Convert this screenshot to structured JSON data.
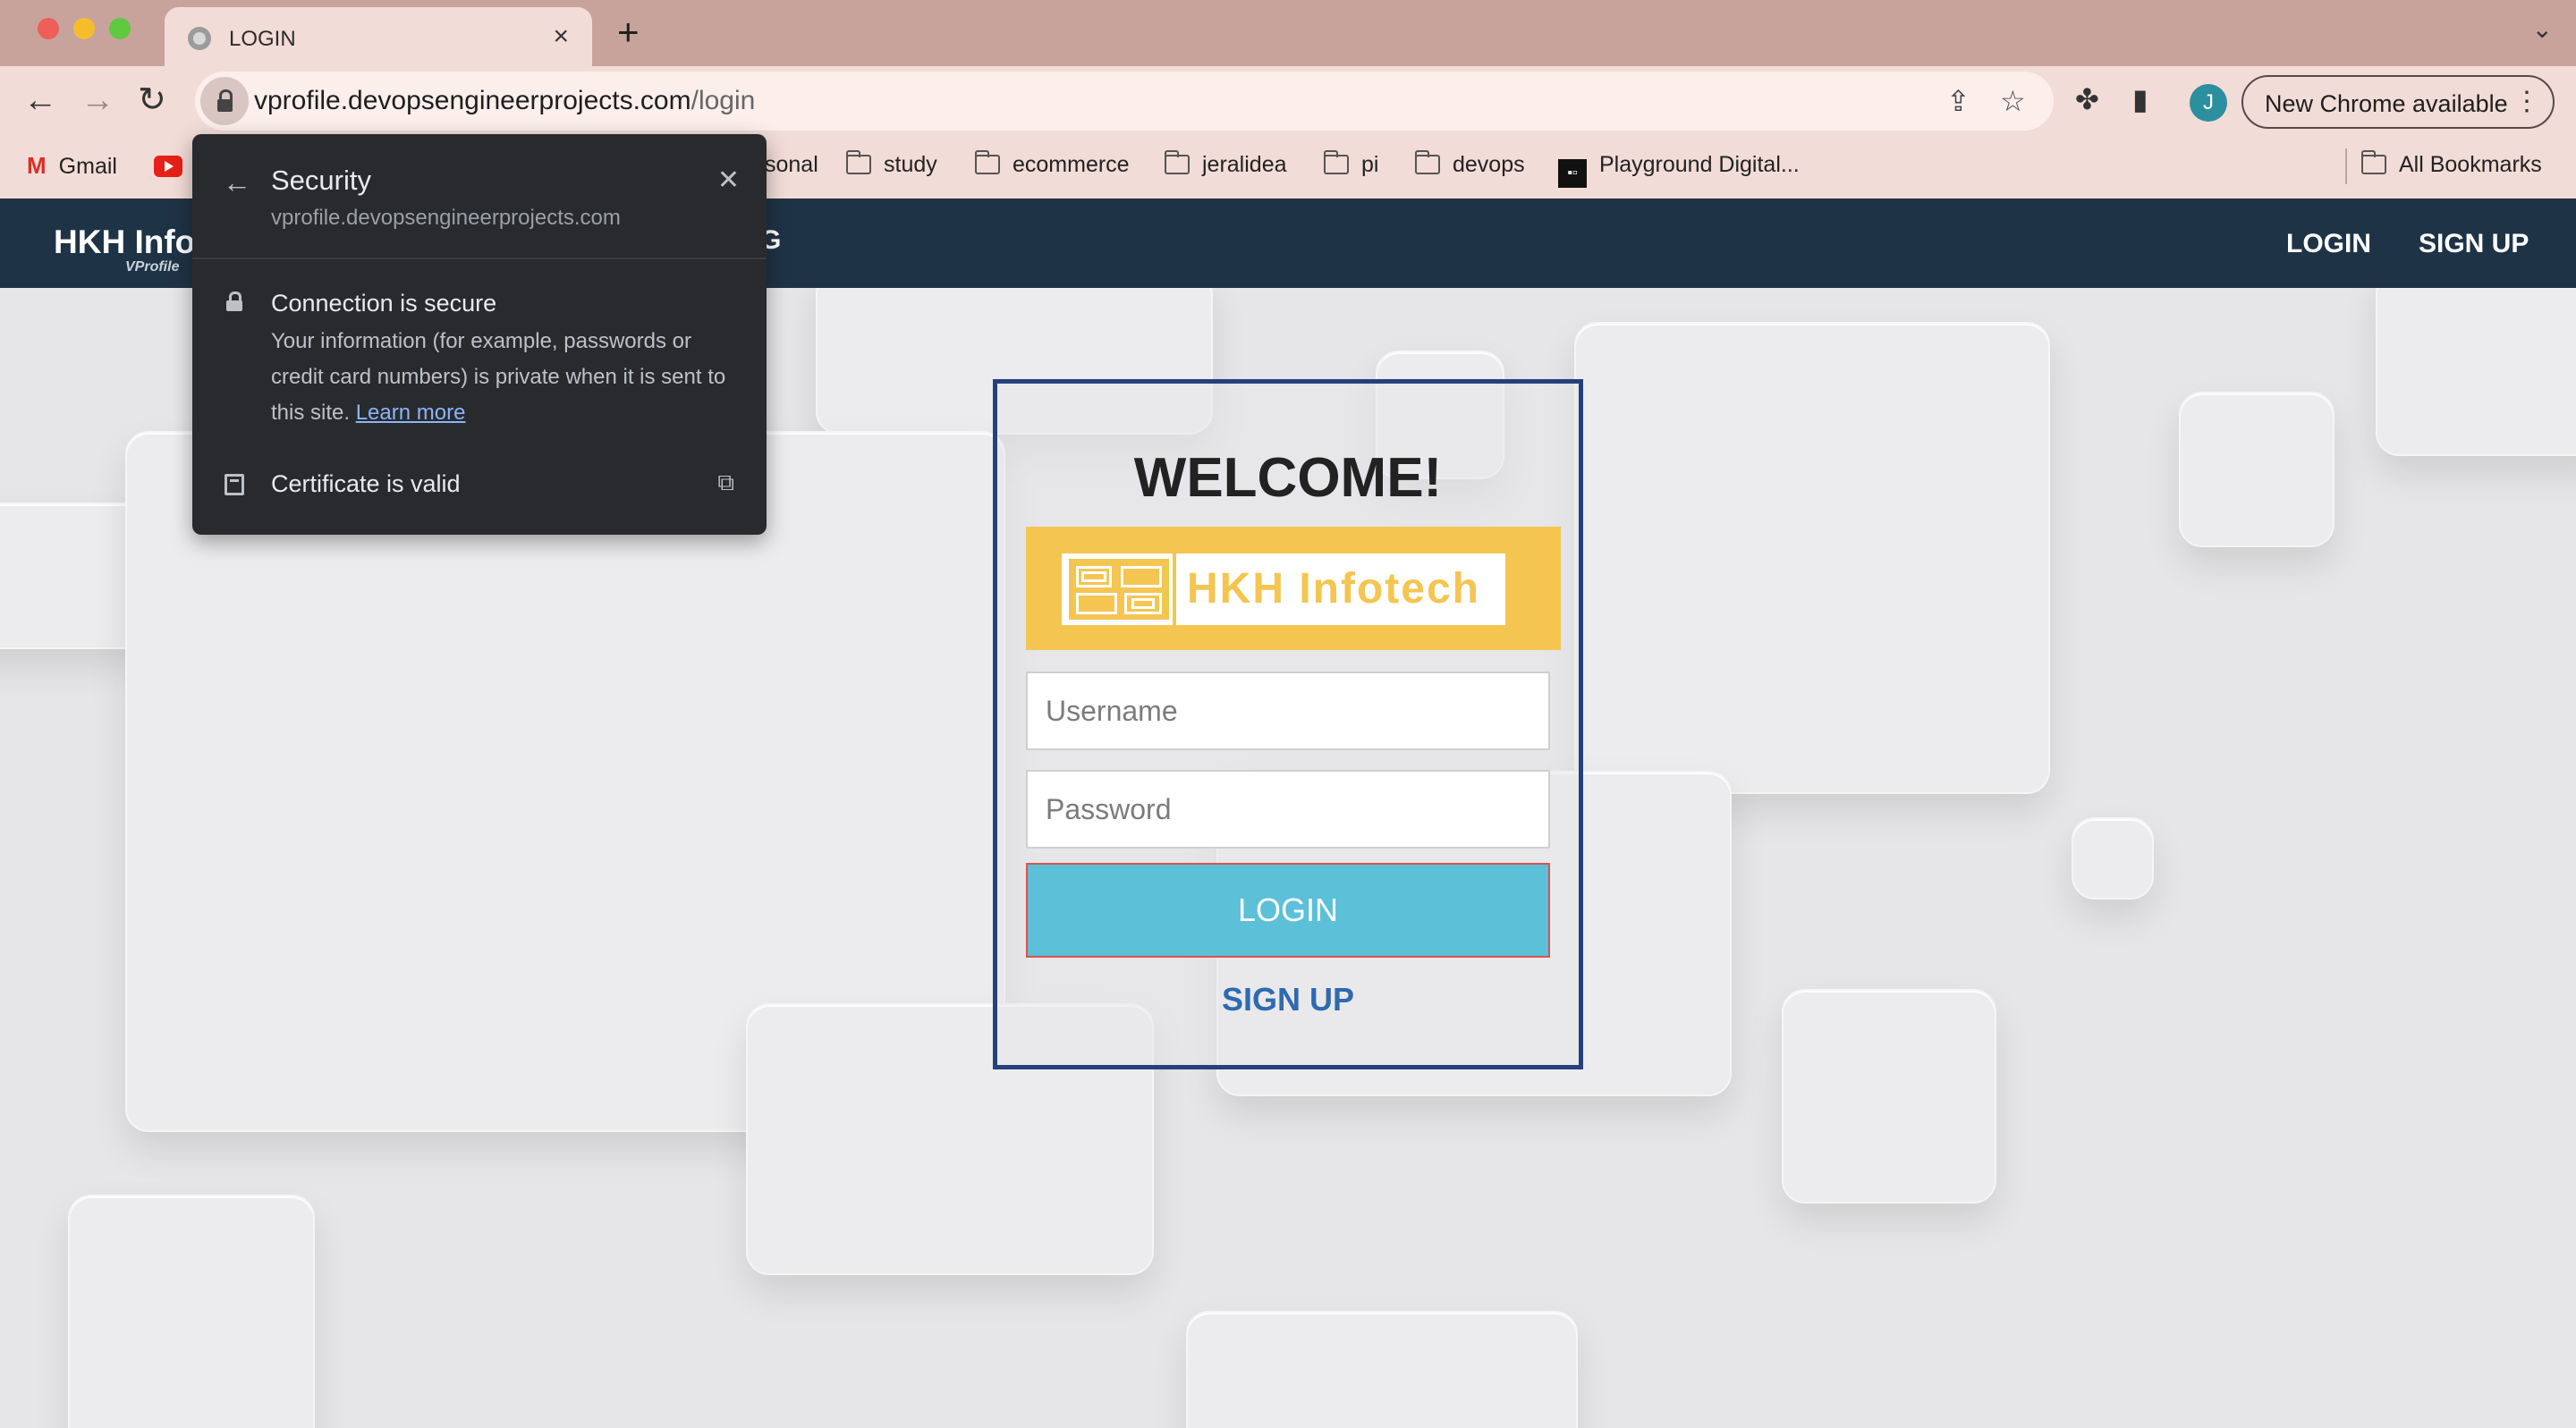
{
  "browser": {
    "tab_title": "LOGIN",
    "url_host": "vprofile.devopsengineerprojects.com",
    "url_path": "/login",
    "profile_initial": "J",
    "update_label": "New Chrome available"
  },
  "bookmarks": {
    "gmail": "Gmail",
    "partial": "sonal",
    "study": "study",
    "ecommerce": "ecommerce",
    "jeralidea": "jeralidea",
    "pi": "pi",
    "devops": "devops",
    "playground": "Playground Digital...",
    "all": "All Bookmarks"
  },
  "security_popup": {
    "title": "Security",
    "host": "vprofile.devopsengineerprojects.com",
    "connection": "Connection is secure",
    "description": "Your information (for example, passwords or credit card numbers) is private when it is sent to this site.",
    "learn_more": "Learn more",
    "certificate": "Certificate is valid"
  },
  "site": {
    "brand": "HKH Info",
    "brand_sub": "VProfile",
    "hidden_nav_fragment": "G",
    "nav_login": "LOGIN",
    "nav_signup": "SIGN UP",
    "welcome": "WELCOME!",
    "logo_text": "HKH Infotech",
    "username_placeholder": "Username",
    "password_placeholder": "Password",
    "login_button": "LOGIN",
    "signup_link": "SIGN UP"
  },
  "colors": {
    "navbar": "#1f3346",
    "card_border": "#25417c",
    "logo_yellow": "#f4c551",
    "login_button": "#5bc0d8",
    "signup_link": "#2f6ab0"
  }
}
